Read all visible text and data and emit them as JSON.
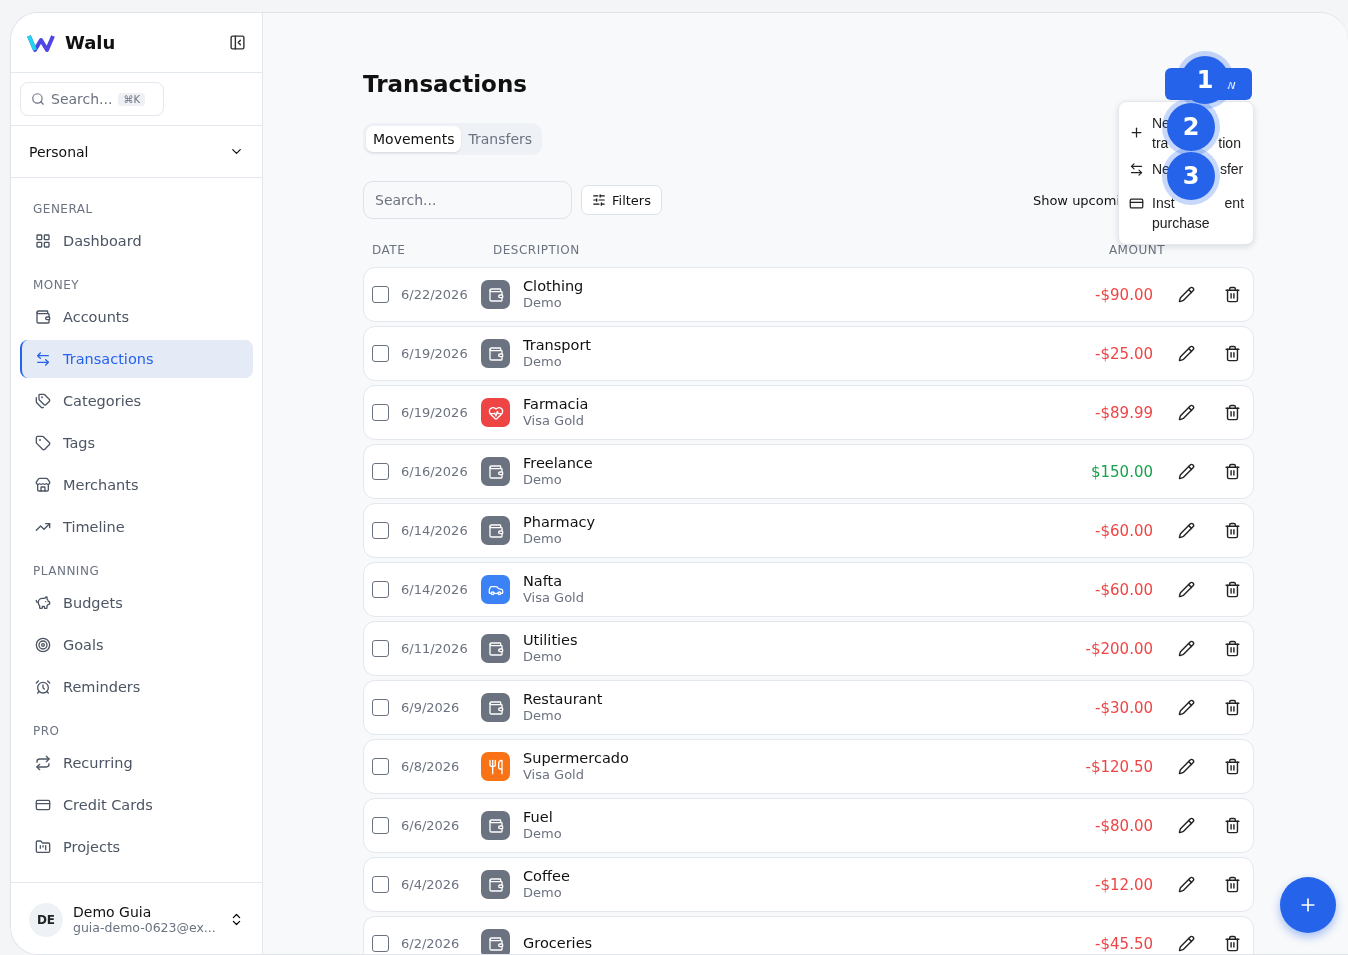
{
  "app": {
    "name": "Walu"
  },
  "sidebar": {
    "search": {
      "placeholder": "Search...",
      "shortcut": "⌘K"
    },
    "workspace": "Personal",
    "sections": [
      {
        "title": "GENERAL",
        "items": [
          {
            "label": "Dashboard",
            "selected": false
          }
        ]
      },
      {
        "title": "MONEY",
        "items": [
          {
            "label": "Accounts",
            "selected": false
          },
          {
            "label": "Transactions",
            "selected": true
          },
          {
            "label": "Categories",
            "selected": false
          },
          {
            "label": "Tags",
            "selected": false
          },
          {
            "label": "Merchants",
            "selected": false
          },
          {
            "label": "Timeline",
            "selected": false
          }
        ]
      },
      {
        "title": "PLANNING",
        "items": [
          {
            "label": "Budgets",
            "selected": false
          },
          {
            "label": "Goals",
            "selected": false
          },
          {
            "label": "Reminders",
            "selected": false
          }
        ]
      },
      {
        "title": "PRO",
        "items": [
          {
            "label": "Recurring",
            "selected": false
          },
          {
            "label": "Credit Cards",
            "selected": false
          },
          {
            "label": "Projects",
            "selected": false
          }
        ]
      }
    ],
    "user": {
      "initials": "DE",
      "name": "Demo Guia",
      "email": "guia-demo-0623@ex..."
    }
  },
  "page": {
    "title": "Transactions",
    "new_button": "w",
    "tabs": [
      {
        "label": "Movements",
        "selected": true
      },
      {
        "label": "Transfers",
        "selected": false
      }
    ],
    "search": {
      "placeholder": "Search..."
    },
    "filters": "Filters",
    "show_upcoming": "Show upcomi",
    "menu": [
      {
        "lines": [
          [
            "Ne"
          ],
          [
            "tra",
            "tion"
          ]
        ]
      },
      {
        "lines": [
          [
            "Ne",
            "sfer"
          ]
        ]
      },
      {
        "lines": [
          [
            "Inst",
            "ent"
          ],
          [
            "purchase"
          ]
        ]
      }
    ],
    "markers": [
      "1",
      "2",
      "3"
    ],
    "columns": [
      "DATE",
      "DESCRIPTION",
      "AMOUNT"
    ],
    "rows": [
      {
        "date": "6/22/2026",
        "title": "Clothing",
        "account": "Demo",
        "amount": "-$90.00",
        "positive": false,
        "kind": "wallet",
        "color": "#6b7280",
        "checked": false
      },
      {
        "date": "6/19/2026",
        "title": "Transport",
        "account": "Demo",
        "amount": "-$25.00",
        "positive": false,
        "kind": "wallet",
        "color": "#6b7280",
        "checked": false
      },
      {
        "date": "6/19/2026",
        "title": "Farmacia",
        "account": "Visa Gold",
        "amount": "-$89.99",
        "positive": false,
        "kind": "health",
        "color": "#ef4444",
        "checked": false
      },
      {
        "date": "6/16/2026",
        "title": "Freelance",
        "account": "Demo",
        "amount": "$150.00",
        "positive": true,
        "kind": "wallet",
        "color": "#6b7280",
        "checked": false
      },
      {
        "date": "6/14/2026",
        "title": "Pharmacy",
        "account": "Demo",
        "amount": "-$60.00",
        "positive": false,
        "kind": "wallet",
        "color": "#6b7280",
        "checked": false
      },
      {
        "date": "6/14/2026",
        "title": "Nafta",
        "account": "Visa Gold",
        "amount": "-$60.00",
        "positive": false,
        "kind": "car",
        "color": "#3b82f6",
        "checked": false
      },
      {
        "date": "6/11/2026",
        "title": "Utilities",
        "account": "Demo",
        "amount": "-$200.00",
        "positive": false,
        "kind": "wallet",
        "color": "#6b7280",
        "checked": false
      },
      {
        "date": "6/9/2026",
        "title": "Restaurant",
        "account": "Demo",
        "amount": "-$30.00",
        "positive": false,
        "kind": "wallet",
        "color": "#6b7280",
        "checked": false
      },
      {
        "date": "6/8/2026",
        "title": "Supermercado",
        "account": "Visa Gold",
        "amount": "-$120.50",
        "positive": false,
        "kind": "food",
        "color": "#f97316",
        "checked": false
      },
      {
        "date": "6/6/2026",
        "title": "Fuel",
        "account": "Demo",
        "amount": "-$80.00",
        "positive": false,
        "kind": "wallet",
        "color": "#6b7280",
        "checked": false
      },
      {
        "date": "6/4/2026",
        "title": "Coffee",
        "account": "Demo",
        "amount": "-$12.00",
        "positive": false,
        "kind": "wallet",
        "color": "#6b7280",
        "checked": false
      },
      {
        "date": "6/2/2026",
        "title": "Groceries",
        "amount": "-$45.50",
        "positive": false,
        "kind": "wallet",
        "color": "#6b7280",
        "checked": false
      }
    ]
  }
}
